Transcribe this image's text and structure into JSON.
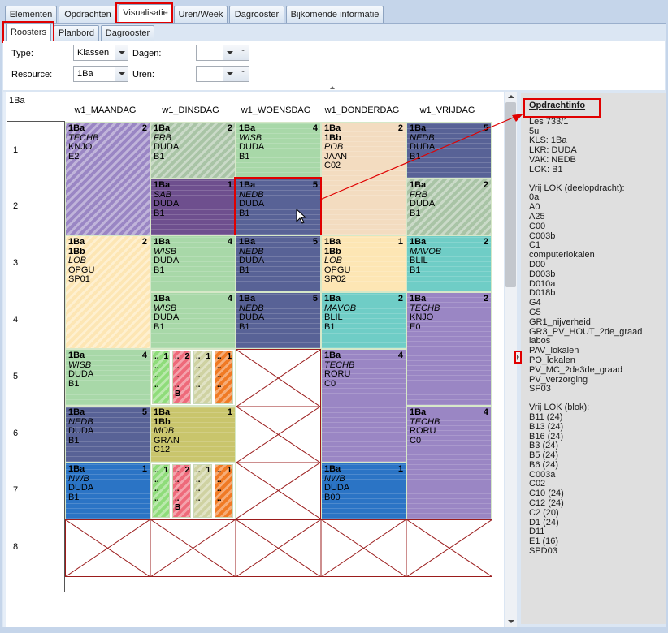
{
  "top_tabs": [
    "Elementen",
    "Opdrachten",
    "Visualisatie",
    "Uren/Week",
    "Dagrooster",
    "Bijkomende informatie"
  ],
  "sub_tabs": [
    "Roosters",
    "Planbord",
    "Dagrooster"
  ],
  "filters": {
    "type_label": "Type:",
    "type_value": "Klassen",
    "resource_label": "Resource:",
    "resource_value": "1Ba",
    "dagen_label": "Dagen:",
    "dagen_value": "",
    "uren_label": "Uren:",
    "uren_value": "",
    "ellipsis": "···"
  },
  "grid": {
    "corner": "1Ba",
    "days": [
      "w1_MAANDAG",
      "w1_DINSDAG",
      "w1_WOENSDAG",
      "w1_DONDERDAG",
      "w1_VRIJDAG"
    ],
    "rows": [
      "1",
      "2",
      "3",
      "4",
      "5",
      "6",
      "7",
      "8"
    ]
  },
  "colors": {
    "techb": "#9a86c4",
    "frb": "#a9c4a6",
    "wisb": "#a8d8a8",
    "nedb": "#586296",
    "pob": "#f3dcc0",
    "sab": "#6e4f8e",
    "lob": "#fde6b4",
    "mavob": "#6fcdc6",
    "mob": "#c9c56c",
    "nwb": "#2b74c5",
    "accent": "#e00000"
  },
  "lessons": {
    "mon_1": {
      "l1": "1Ba",
      "l2": "TECHB",
      "l3": "KNJO",
      "l4": "E2",
      "n": "2"
    },
    "tue_1": {
      "l1": "1Ba",
      "l2": "FRB",
      "l3": "DUDA",
      "l4": "B1",
      "n": "2"
    },
    "wed_1": {
      "l1": "1Ba",
      "l2": "WISB",
      "l3": "DUDA",
      "l4": "B1",
      "n": "4"
    },
    "thu_1": {
      "l1": "1Ba",
      "l2": "1Bb",
      "l3": "POB",
      "l4": "JAAN",
      "l5": "C02",
      "n": "2"
    },
    "fri_1": {
      "l1": "1Ba",
      "l2": "NEDB",
      "l3": "DUDA",
      "l4": "B1",
      "n": "5"
    },
    "tue_2": {
      "l1": "1Ba",
      "l2": "SAB",
      "l3": "DUDA",
      "l4": "B1",
      "n": "1"
    },
    "wed_2": {
      "l1": "1Ba",
      "l2": "NEDB",
      "l3": "DUDA",
      "l4": "B1",
      "n": "5"
    },
    "fri_2": {
      "l1": "1Ba",
      "l2": "FRB",
      "l3": "DUDA",
      "l4": "B1",
      "n": "2"
    },
    "mon_3": {
      "l1": "1Ba",
      "l2": "1Bb",
      "l3": "LOB",
      "l4": "OPGU",
      "l5": "SP01",
      "n": "2"
    },
    "tue_3": {
      "l1": "1Ba",
      "l2": "WISB",
      "l3": "DUDA",
      "l4": "B1",
      "n": "4"
    },
    "wed_3": {
      "l1": "1Ba",
      "l2": "NEDB",
      "l3": "DUDA",
      "l4": "B1",
      "n": "5"
    },
    "thu_3": {
      "l1": "1Ba",
      "l2": "1Bb",
      "l3": "LOB",
      "l4": "OPGU",
      "l5": "SP02",
      "n": "1"
    },
    "fri_3": {
      "l1": "1Ba",
      "l2": "MAVOB",
      "l3": "BLIL",
      "l4": "B1",
      "n": "2"
    },
    "tue_4": {
      "l1": "1Ba",
      "l2": "WISB",
      "l3": "DUDA",
      "l4": "B1",
      "n": "4"
    },
    "wed_4": {
      "l1": "1Ba",
      "l2": "NEDB",
      "l3": "DUDA",
      "l4": "B1",
      "n": "5"
    },
    "thu_4": {
      "l1": "1Ba",
      "l2": "MAVOB",
      "l3": "BLIL",
      "l4": "B1",
      "n": "2"
    },
    "fri_4": {
      "l1": "1Ba",
      "l2": "TECHB",
      "l3": "KNJO",
      "l4": "E0",
      "n": "2"
    },
    "mon_5": {
      "l1": "1Ba",
      "l2": "WISB",
      "l3": "DUDA",
      "l4": "B1",
      "n": "4"
    },
    "thu_5": {
      "l1": "1Ba",
      "l2": "TECHB",
      "l3": "RORU",
      "l4": "C0",
      "n": "4"
    },
    "mon_6": {
      "l1": "1Ba",
      "l2": "NEDB",
      "l3": "DUDA",
      "l4": "B1",
      "n": "5"
    },
    "tue_6": {
      "l1": "1Ba",
      "l2": "1Bb",
      "l3": "MOB",
      "l4": "GRAN",
      "l5": "C12",
      "n": "1"
    },
    "fri_6": {
      "l1": "1Ba",
      "l2": "TECHB",
      "l3": "RORU",
      "l4": "C0",
      "n": "4"
    },
    "mon_7": {
      "l1": "1Ba",
      "l2": "NWB",
      "l3": "DUDA",
      "l4": "B1",
      "n": "1"
    },
    "thu_7": {
      "l1": "1Ba",
      "l2": "NWB",
      "l3": "DUDA",
      "l4": "B00",
      "n": "1"
    }
  },
  "mini": {
    "dots": "..",
    "nums": [
      "1",
      "2",
      "1",
      "1"
    ],
    "b": "B"
  },
  "info": {
    "title": "Opdrachtinfo",
    "lines": [
      "Les 733/1",
      "5u",
      "KLS:  1Ba",
      "LKR: DUDA",
      "VAK: NEDB",
      "LOK: B1"
    ],
    "vrij_title": "Vrij LOK (deelopdracht):",
    "vrij": [
      "0a",
      "A0",
      "A25",
      "C00",
      "C003b",
      "C1",
      "computerlokalen",
      "D00",
      "D003b",
      "D010a",
      "D018b",
      "G4",
      "G5",
      "GR1_nijverheid",
      "GR3_PV_HOUT_2de_graad",
      "labos",
      "PAV_lokalen",
      "PO_lokalen",
      "PV_MC_2de3de_graad",
      "PV_verzorging",
      "SP03"
    ],
    "blok_title": "Vrij LOK (blok):",
    "blok": [
      "B11 (24)",
      "B13 (24)",
      "B16 (24)",
      "B3 (24)",
      "B5 (24)",
      "B6 (24)",
      "C003a",
      "C02",
      "C10 (24)",
      "C12 (24)",
      "C2 (20)",
      "D1 (24)",
      "D11",
      "E1 (16)",
      "SPD03"
    ]
  }
}
